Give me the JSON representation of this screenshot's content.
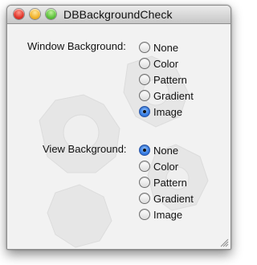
{
  "window": {
    "title": "DBBackgroundCheck"
  },
  "window_background": {
    "label": "Window Background:",
    "options": [
      "None",
      "Color",
      "Pattern",
      "Gradient",
      "Image"
    ],
    "selected": "Image"
  },
  "view_background": {
    "label": "View Background:",
    "options": [
      "None",
      "Color",
      "Pattern",
      "Gradient",
      "Image"
    ],
    "selected": "None"
  },
  "colors": {
    "radio_selected": "#3c82e6",
    "gear_shade": "#e3e3e3"
  }
}
